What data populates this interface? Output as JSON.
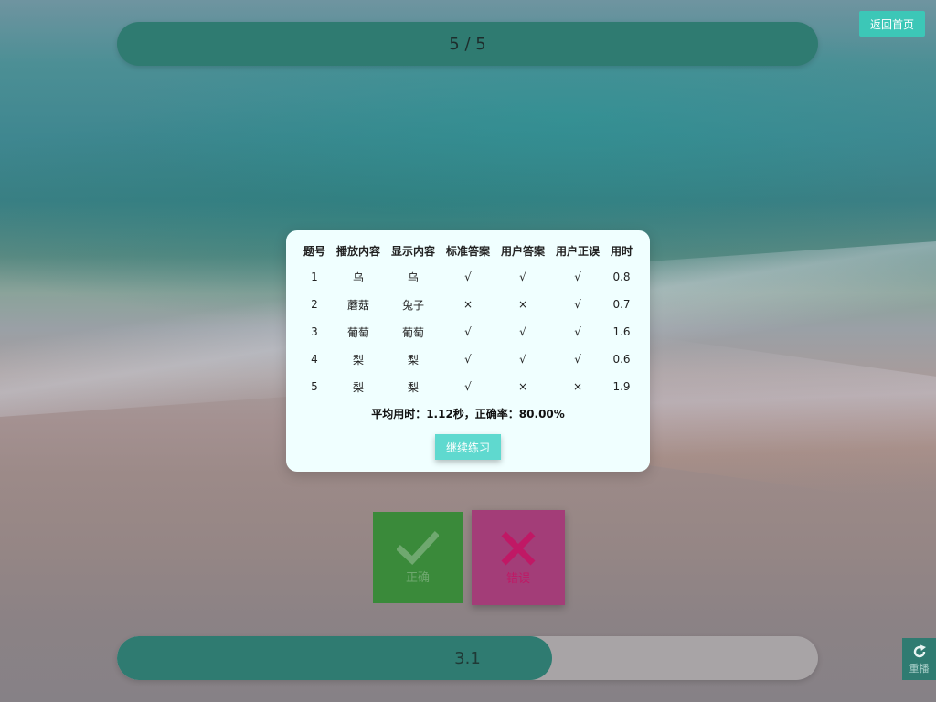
{
  "header": {
    "progress_text": "5 / 5",
    "home_label": "返回首页"
  },
  "results_modal": {
    "columns": [
      "题号",
      "播放内容",
      "显示内容",
      "标准答案",
      "用户答案",
      "用户正误",
      "用时"
    ],
    "rows": [
      [
        "1",
        "乌",
        "乌",
        "√",
        "√",
        "√",
        "0.8"
      ],
      [
        "2",
        "蘑菇",
        "兔子",
        "×",
        "×",
        "√",
        "0.7"
      ],
      [
        "3",
        "葡萄",
        "葡萄",
        "√",
        "√",
        "√",
        "1.6"
      ],
      [
        "4",
        "梨",
        "梨",
        "√",
        "√",
        "√",
        "0.6"
      ],
      [
        "5",
        "梨",
        "梨",
        "√",
        "×",
        "×",
        "1.9"
      ]
    ],
    "summary": "平均用时：1.12秒，正确率：80.00%",
    "continue_label": "继续练习"
  },
  "answer_buttons": {
    "correct_label": "正确",
    "wrong_label": "错误"
  },
  "timer": {
    "value_text": "3.1",
    "fill_fraction": 0.62
  },
  "replay": {
    "label": "重播"
  },
  "colors": {
    "teal": "#2f7b71",
    "accent": "#3cc7b7",
    "correct": "#3a8a3a",
    "wrong": "#a33d78",
    "modal_bg": "#f0ffff"
  },
  "icons": {
    "correct": "check-icon",
    "wrong": "cross-icon",
    "replay": "refresh-icon"
  }
}
